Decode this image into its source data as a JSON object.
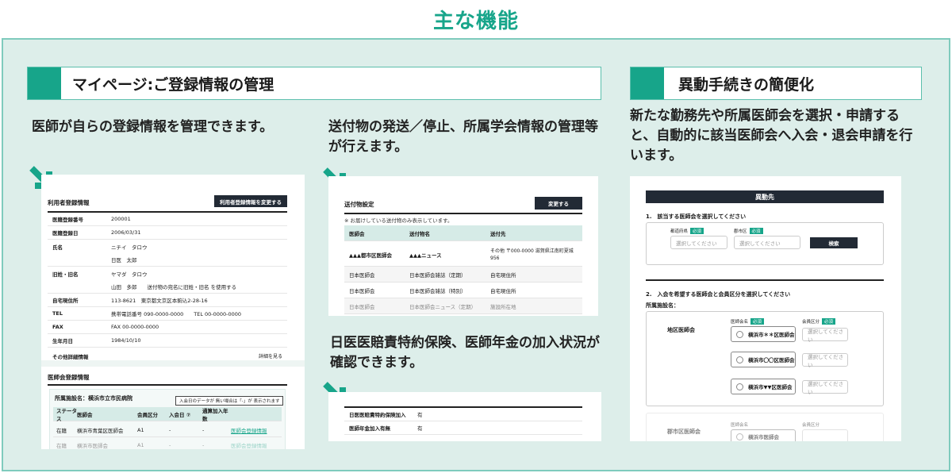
{
  "page_title": "主な機能",
  "colors": {
    "accent": "#17a58a",
    "panel_bg": "#ddeeea",
    "dark_button": "#222a35"
  },
  "left": {
    "header": "マイページ:ご登録情報の管理",
    "desc1": "医師が自らの登録情報を管理できます。",
    "desc2": "送付物の発送／停止、所属学会情報の管理等が行えます。",
    "desc3": "日医医賠責特約保険、医師年金の加入状況が確認できます。"
  },
  "right": {
    "header": "異動手続きの簡便化",
    "desc": "新たな勤務先や所属医師会を選択・申請すると、自動的に該当医師会へ入会・退会申請を行います。"
  },
  "shot1": {
    "title": "利用者登録情報",
    "change_button": "利用者登録情報を変更する",
    "rows": [
      {
        "k": "医籍登録番号",
        "v": "200001"
      },
      {
        "k": "医籍登録日",
        "v": "2006/03/31"
      },
      {
        "k": "氏名",
        "v": "ニチイ　タロウ"
      },
      {
        "k": "",
        "v": "日医　太郎"
      },
      {
        "k": "旧姓・旧名",
        "v": "ヤマダ　タロウ"
      },
      {
        "k": "",
        "v": "山田　多郎　　送付物の宛名に旧姓・旧名 を使用する"
      },
      {
        "k": "自宅現住所",
        "v": "113-8621　東京都文京区本駒込2-28-16"
      },
      {
        "k": "TEL",
        "v": "携帯電話番号 090-0000-0000　　TEL 00-0000-0000"
      },
      {
        "k": "FAX",
        "v": "FAX 00-0000-0000"
      },
      {
        "k": "生年月日",
        "v": "1984/10/10"
      }
    ],
    "other_label": "その他詳細情報",
    "details_link": "詳細を見る",
    "society_title": "医師会登録情報",
    "affiliation": "所属施設名：横浜市立市民病院",
    "tooltip": "入会日のデータが 無い場合は「-」が 表示されます",
    "columns": [
      "ステータス",
      "医師会",
      "会員区分",
      "入会日 ⑦",
      "通算加入年数"
    ],
    "table_rows": [
      {
        "status": "在籍",
        "society": "横浜市青葉区医師会",
        "class": "A1",
        "date": "-",
        "years": "-",
        "link": "医師会登録情報"
      },
      {
        "status": "在籍",
        "society": "横浜市医師会",
        "class": "A1",
        "date": "-",
        "years": "-",
        "link": "医師会登録情報"
      }
    ]
  },
  "shot2": {
    "title": "送付物設定",
    "change_button": "変更する",
    "note": "※ お届けしている送付物のみ表示しています。",
    "columns": [
      "医師会",
      "送付物名",
      "送付先"
    ],
    "rows": [
      {
        "society": "▲▲▲都市区医師会",
        "item": "▲▲▲ニュース",
        "dest": "その他 〒000-0000 滋賀県江南町夏城956"
      },
      {
        "society": "日本医師会",
        "item": "日本医師会雑誌（定期）",
        "dest": "自宅現住所"
      },
      {
        "society": "日本医師会",
        "item": "日本医師会雑誌（特別）",
        "dest": "自宅現住所"
      },
      {
        "society": "日本医師会",
        "item": "日本医師会ニュース（定期）",
        "dest": "施設所在地"
      }
    ]
  },
  "shot3": {
    "rows": [
      {
        "k": "日医医賠責特約保険加入",
        "v": "有"
      },
      {
        "k": "医師年金加入有無",
        "v": "有"
      }
    ]
  },
  "shot4": {
    "header": "異動先",
    "step1": "1.　該当する医師会を選択してください",
    "pref_label": "都道府県",
    "city_label": "郡市区",
    "required": "必須",
    "select_placeholder": "選択してください",
    "search_button": "検索",
    "step2": "2.　入会を希望する医師会と会員区分を選択してください",
    "affiliation_label": "所属施設名：",
    "area_label": "地区医師会",
    "society_col": "医師会名",
    "member_col": "会員区分",
    "options": [
      "横浜市＊＊区医師会",
      "横浜市〇〇区医師会",
      "横浜市▼▼区医師会"
    ],
    "city_society_label": "郡市区医師会",
    "city_option": "横浜市医師会"
  }
}
